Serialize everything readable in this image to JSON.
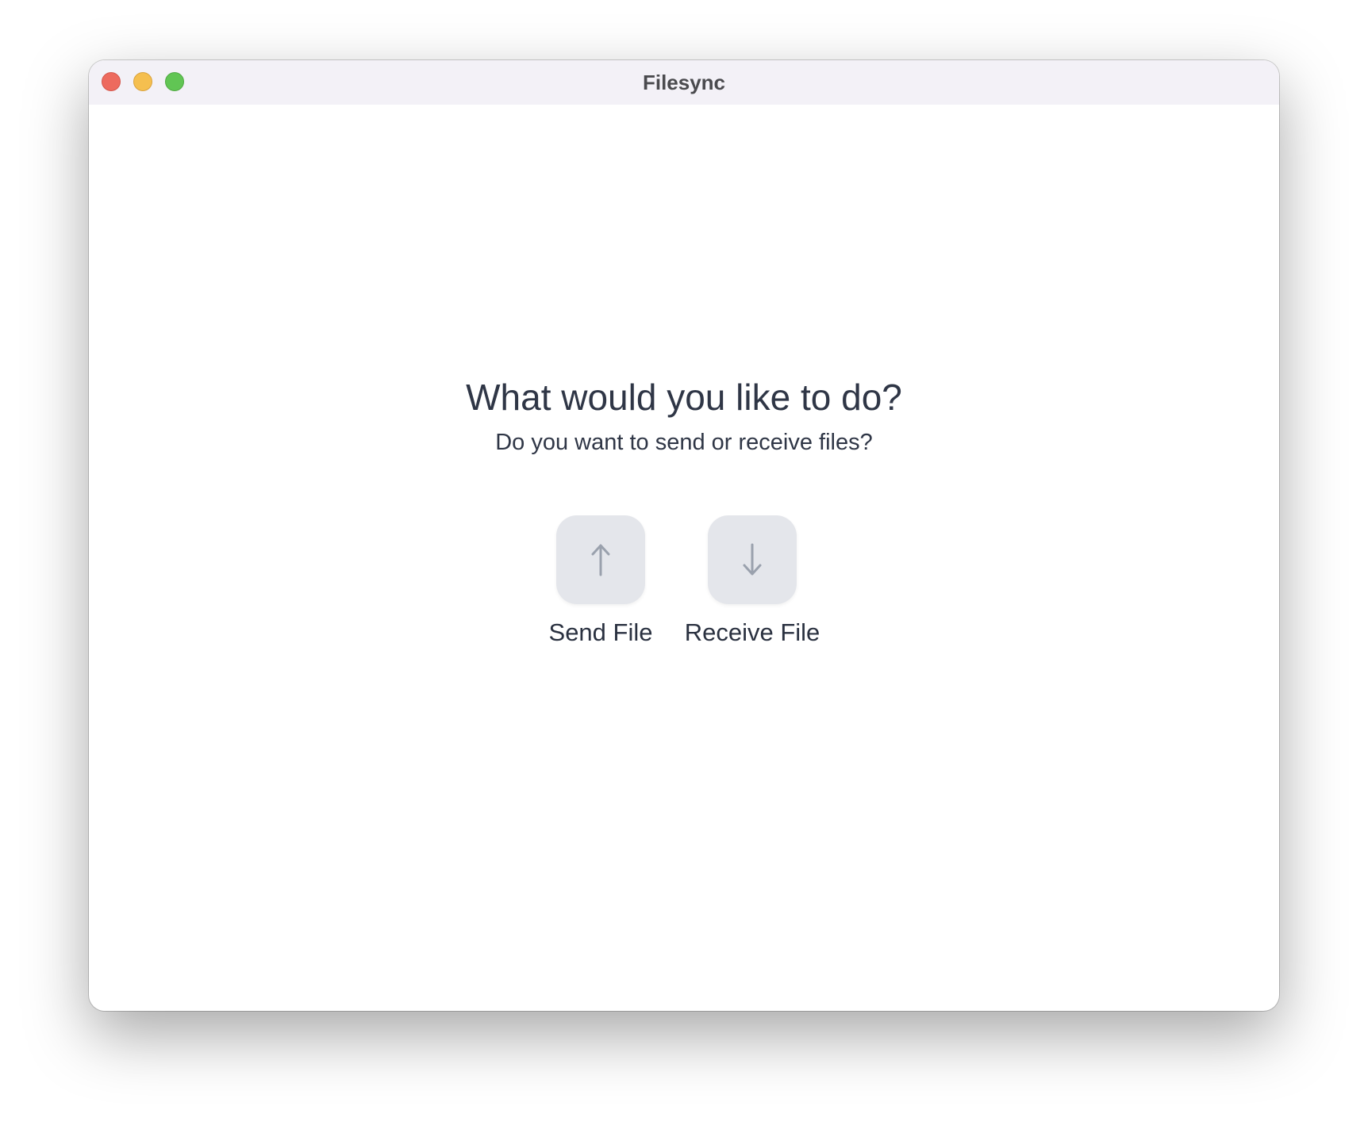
{
  "window": {
    "title": "Filesync"
  },
  "main": {
    "heading": "What would you like to do?",
    "subheading": "Do you want to send or receive files?",
    "options": [
      {
        "label": "Send File",
        "icon": "arrow-up-icon"
      },
      {
        "label": "Receive File",
        "icon": "arrow-down-icon"
      }
    ]
  },
  "colors": {
    "tile": "#e4e6eb",
    "arrow": "#9aa1ad",
    "text": "#2f3646",
    "titlebar": "#f3f1f7"
  }
}
